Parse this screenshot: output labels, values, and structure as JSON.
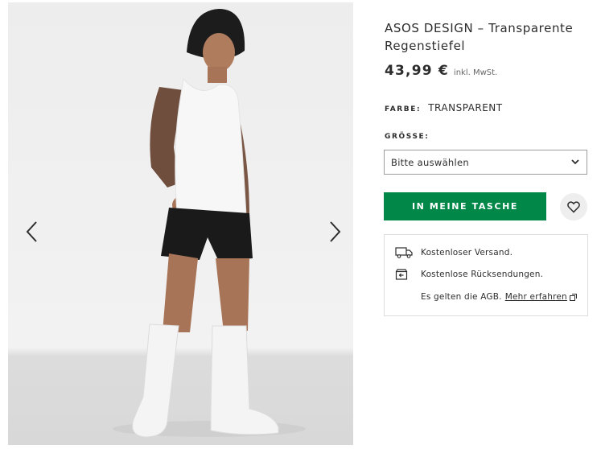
{
  "gallery": {
    "prev_icon": "chevron-left-icon",
    "next_icon": "chevron-right-icon"
  },
  "product": {
    "title": "ASOS DESIGN – Transparente Regenstiefel",
    "price": "43,99 €",
    "vat_note": "inkl. MwSt.",
    "colour_label": "FARBE:",
    "colour_value": "TRANSPARENT",
    "size_label": "GRÖSSE:",
    "size_select_value": "Bitte auswählen",
    "add_to_bag_label": "IN MEINE TASCHE",
    "wishlist_icon": "heart-icon"
  },
  "delivery": {
    "shipping_text": "Kostenloser Versand.",
    "shipping_icon": "truck-icon",
    "returns_text": "Kostenlose Rücksendungen.",
    "returns_icon": "return-box-icon",
    "terms_text": "Es gelten die AGB.",
    "terms_link": "Mehr erfahren",
    "terms_link_icon": "external-link-icon"
  },
  "colors": {
    "accent_green": "#018849",
    "text": "#2d2d2d",
    "border": "#dddddd"
  }
}
